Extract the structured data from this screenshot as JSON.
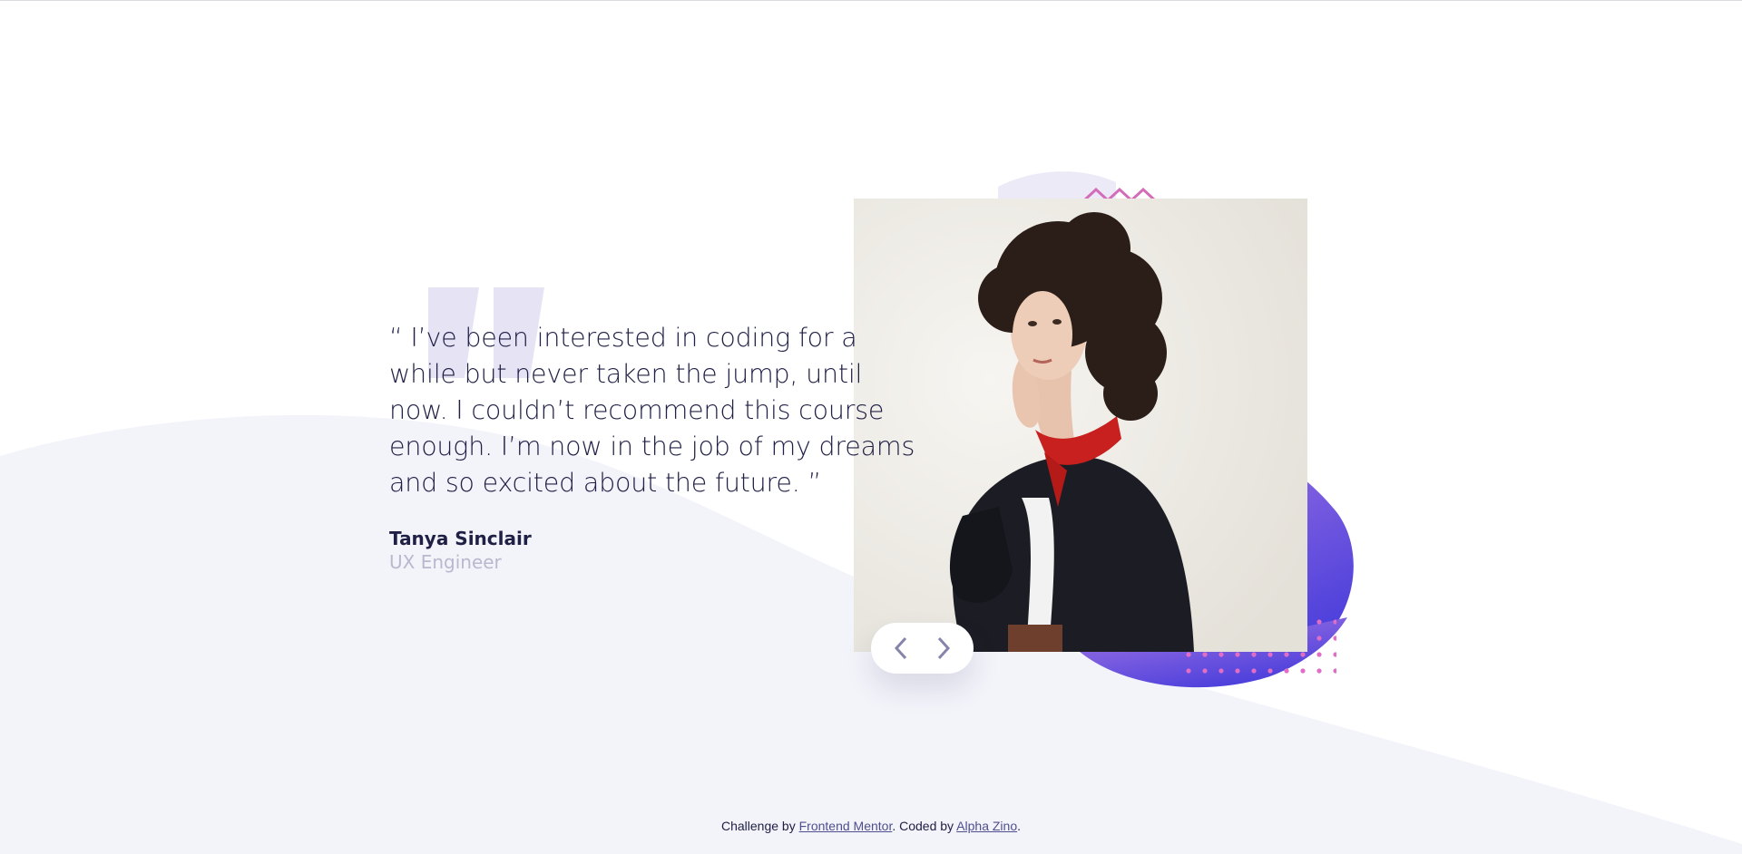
{
  "testimonial": {
    "quote": "“ I’ve been interested in coding for a while but never taken the jump, until now. I couldn’t recommend this course enough. I’m now in the job of my dreams and so excited about the future. ”",
    "author_name": "Tanya Sinclair",
    "author_role": "UX Engineer"
  },
  "navigation": {
    "prev_icon": "chevron-left-icon",
    "next_icon": "chevron-right-icon"
  },
  "footer": {
    "prefix": "Challenge by ",
    "link1": "Frontend Mentor",
    "middle": ". Coded by ",
    "link2": "Alpha Zino",
    "suffix": "."
  },
  "colors": {
    "text_dark": "#202046",
    "text_muted": "#b8b8cf",
    "curve_bg": "#f3f3fa",
    "blob_start": "#9b6ee0",
    "blob_end": "#4b3fdc",
    "dots_pattern": "#e06dc6",
    "nav_arrow": "#8585ac"
  }
}
